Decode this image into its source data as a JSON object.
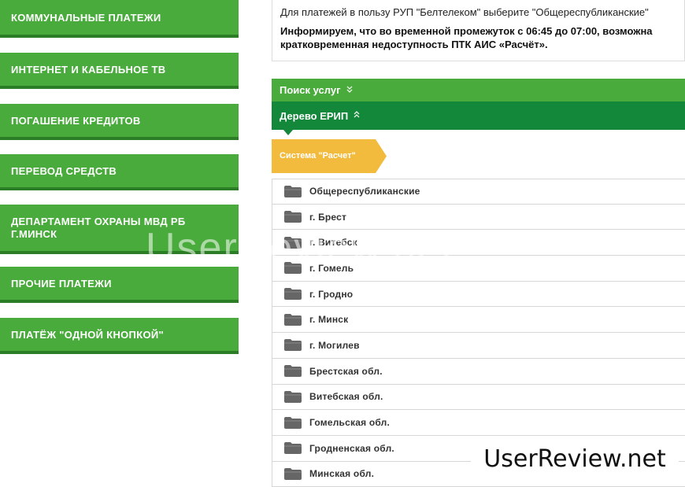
{
  "left_menu": {
    "items": [
      {
        "label": "КОММУНАЛЬНЫЕ ПЛАТЕЖИ"
      },
      {
        "label": "ИНТЕРНЕТ И КАБЕЛЬНОЕ ТВ"
      },
      {
        "label": "ПОГАШЕНИЕ КРЕДИТОВ"
      },
      {
        "label": "ПЕРЕВОД СРЕДСТВ"
      },
      {
        "label": "ДЕПАРТАМЕНТ ОХРАНЫ МВД РБ\nГ.МИНСК"
      },
      {
        "label": "ПРОЧИЕ ПЛАТЕЖИ"
      },
      {
        "label": "ПЛАТЁЖ \"ОДНОЙ КНОПКОЙ\""
      }
    ]
  },
  "info": {
    "line1": "Для платежей в пользу РУП \"Белтелеком\" выберите \"Общереспубликанские\"",
    "line2": "Информируем, что во временной промежуток с 06:45 до 07:00, возможна",
    "line3": "кратковременная недоступность ПТК АИС «Расчёт»."
  },
  "search_bar": {
    "label": "Поиск услуг",
    "icon": "chevron-double-down-icon"
  },
  "tree_bar": {
    "label": "Дерево ЕРИП",
    "icon": "chevron-double-up-icon"
  },
  "breadcrumb": {
    "label": "Система \"Расчет\""
  },
  "tree": {
    "items": [
      {
        "label": "Общереспубликанские"
      },
      {
        "label": "г. Брест"
      },
      {
        "label": "г. Витебск"
      },
      {
        "label": "г. Гомель"
      },
      {
        "label": "г. Гродно"
      },
      {
        "label": "г. Минск"
      },
      {
        "label": "г. Могилев"
      },
      {
        "label": "Брестская обл."
      },
      {
        "label": "Витебская обл."
      },
      {
        "label": "Гомельская обл."
      },
      {
        "label": "Гродненская обл."
      },
      {
        "label": "Минская обл."
      }
    ]
  },
  "watermark": {
    "text": "UserReview.net",
    "faint": "UserReview.net"
  },
  "colors": {
    "menu_green": "#4aab3d",
    "menu_green_dark": "#2b7e25",
    "tree_bar": "#13883b",
    "breadcrumb_yellow": "#f3bb3d",
    "folder_gray": "#666666"
  }
}
